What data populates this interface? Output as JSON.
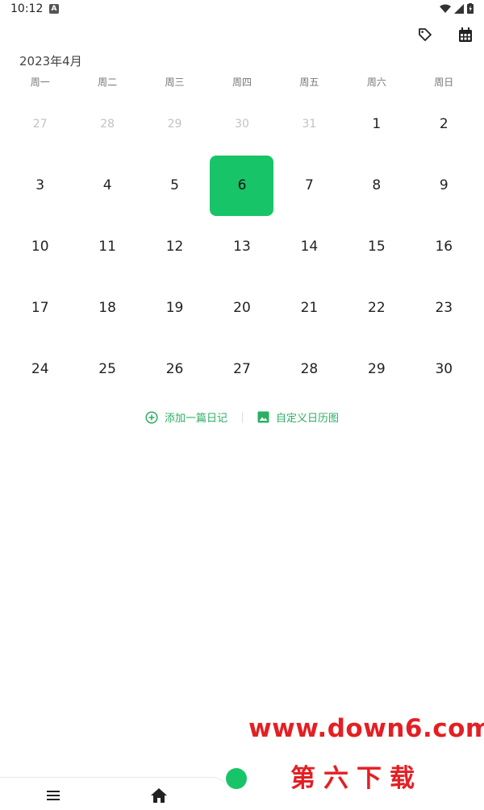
{
  "status": {
    "time": "10:12",
    "notif": "A"
  },
  "calendar": {
    "month_title": "2023年4月",
    "weekdays": [
      "周一",
      "周二",
      "周三",
      "周四",
      "周五",
      "周六",
      "周日"
    ],
    "days": [
      {
        "label": "27",
        "muted": true
      },
      {
        "label": "28",
        "muted": true
      },
      {
        "label": "29",
        "muted": true
      },
      {
        "label": "30",
        "muted": true
      },
      {
        "label": "31",
        "muted": true
      },
      {
        "label": "1"
      },
      {
        "label": "2"
      },
      {
        "label": "3"
      },
      {
        "label": "4"
      },
      {
        "label": "5"
      },
      {
        "label": "6",
        "selected": true
      },
      {
        "label": "7"
      },
      {
        "label": "8"
      },
      {
        "label": "9"
      },
      {
        "label": "10"
      },
      {
        "label": "11"
      },
      {
        "label": "12"
      },
      {
        "label": "13"
      },
      {
        "label": "14"
      },
      {
        "label": "15"
      },
      {
        "label": "16"
      },
      {
        "label": "17"
      },
      {
        "label": "18"
      },
      {
        "label": "19"
      },
      {
        "label": "20"
      },
      {
        "label": "21"
      },
      {
        "label": "22"
      },
      {
        "label": "23"
      },
      {
        "label": "24"
      },
      {
        "label": "25"
      },
      {
        "label": "26"
      },
      {
        "label": "27"
      },
      {
        "label": "28"
      },
      {
        "label": "29"
      },
      {
        "label": "30"
      }
    ]
  },
  "actions": {
    "add_diary": "添加一篇日记",
    "custom_calendar": "自定义日历图"
  },
  "watermark": {
    "url": "www.down6.com",
    "name": "第六下载"
  },
  "colors": {
    "accent": "#18c468",
    "action_text": "#2cae64",
    "watermark": "#e41f23"
  }
}
